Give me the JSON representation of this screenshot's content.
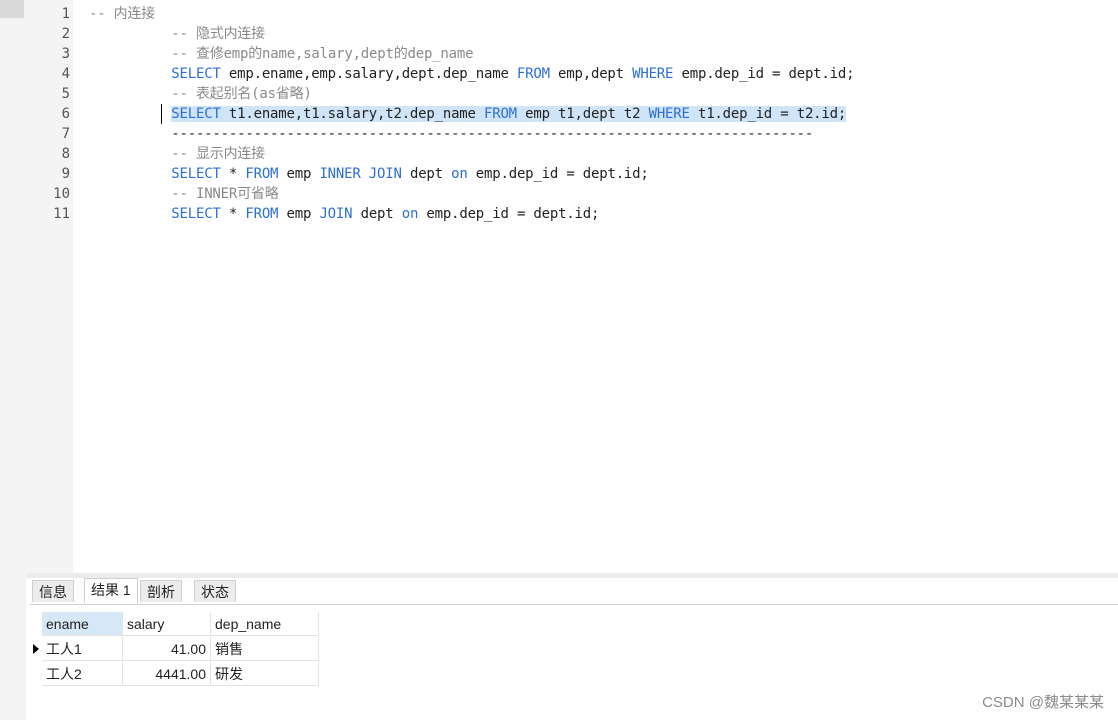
{
  "editor": {
    "line_numbers": [
      "1",
      "2",
      "3",
      "4",
      "5",
      "6",
      "7",
      "8",
      "9",
      "10",
      "11"
    ],
    "lines": [
      [
        {
          "t": "-- 内连接",
          "c": "cmt"
        }
      ],
      [
        {
          "t": "          -- 隐式内连接",
          "c": "cmt"
        }
      ],
      [
        {
          "t": "          -- 查修emp的name,salary,dept的dep_name",
          "c": "cmt"
        }
      ],
      [
        {
          "t": "          ",
          "c": ""
        },
        {
          "t": "SELECT",
          "c": "kw"
        },
        {
          "t": " emp.ename,emp.salary,dept.dep_name ",
          "c": ""
        },
        {
          "t": "FROM",
          "c": "kw"
        },
        {
          "t": " emp,dept ",
          "c": ""
        },
        {
          "t": "WHERE",
          "c": "kw"
        },
        {
          "t": " emp.dep_id = dept.id;",
          "c": ""
        }
      ],
      [
        {
          "t": "          -- 表起别名(as省略)",
          "c": "cmt"
        }
      ],
      [
        {
          "t": "          ",
          "c": ""
        },
        {
          "t": "SELECT",
          "c": "kw hl"
        },
        {
          "t": " t1.ename,t1.salary,t2.dep_name ",
          "c": "hl"
        },
        {
          "t": "FROM",
          "c": "kw hl"
        },
        {
          "t": " emp t1,dept t2 ",
          "c": "hl"
        },
        {
          "t": "WHERE",
          "c": "kw hl"
        },
        {
          "t": " t1.dep_id = t2.id;",
          "c": "hl"
        }
      ],
      [
        {
          "t": "          ------------------------------------------------------------------------------",
          "c": ""
        }
      ],
      [
        {
          "t": "          -- 显示内连接",
          "c": "cmt"
        }
      ],
      [
        {
          "t": "          ",
          "c": ""
        },
        {
          "t": "SELECT",
          "c": "kw"
        },
        {
          "t": " * ",
          "c": ""
        },
        {
          "t": "FROM",
          "c": "kw"
        },
        {
          "t": " emp ",
          "c": ""
        },
        {
          "t": "INNER JOIN",
          "c": "kw"
        },
        {
          "t": " dept ",
          "c": ""
        },
        {
          "t": "on",
          "c": "kw"
        },
        {
          "t": " emp.dep_id = dept.id;",
          "c": ""
        }
      ],
      [
        {
          "t": "          -- INNER可省略",
          "c": "cmt"
        }
      ],
      [
        {
          "t": "          ",
          "c": ""
        },
        {
          "t": "SELECT",
          "c": "kw"
        },
        {
          "t": " * ",
          "c": ""
        },
        {
          "t": "FROM",
          "c": "kw"
        },
        {
          "t": " emp ",
          "c": ""
        },
        {
          "t": "JOIN",
          "c": "kw"
        },
        {
          "t": " dept ",
          "c": ""
        },
        {
          "t": "on",
          "c": "kw"
        },
        {
          "t": " emp.dep_id = dept.id;",
          "c": ""
        }
      ]
    ]
  },
  "tabs": [
    "信息",
    "结果 1",
    "剖析",
    "状态"
  ],
  "active_tab": "结果 1",
  "result": {
    "columns": [
      "ename",
      "salary",
      "dep_name"
    ],
    "rows": [
      [
        "工人1",
        "41.00",
        "销售"
      ],
      [
        "工人2",
        "4441.00",
        "研发"
      ]
    ]
  },
  "watermark": "CSDN @魏某某某",
  "colors": {
    "keyword": "#2c6fd6",
    "comment": "#8a8a8a",
    "selection": "#cfe4f7"
  }
}
